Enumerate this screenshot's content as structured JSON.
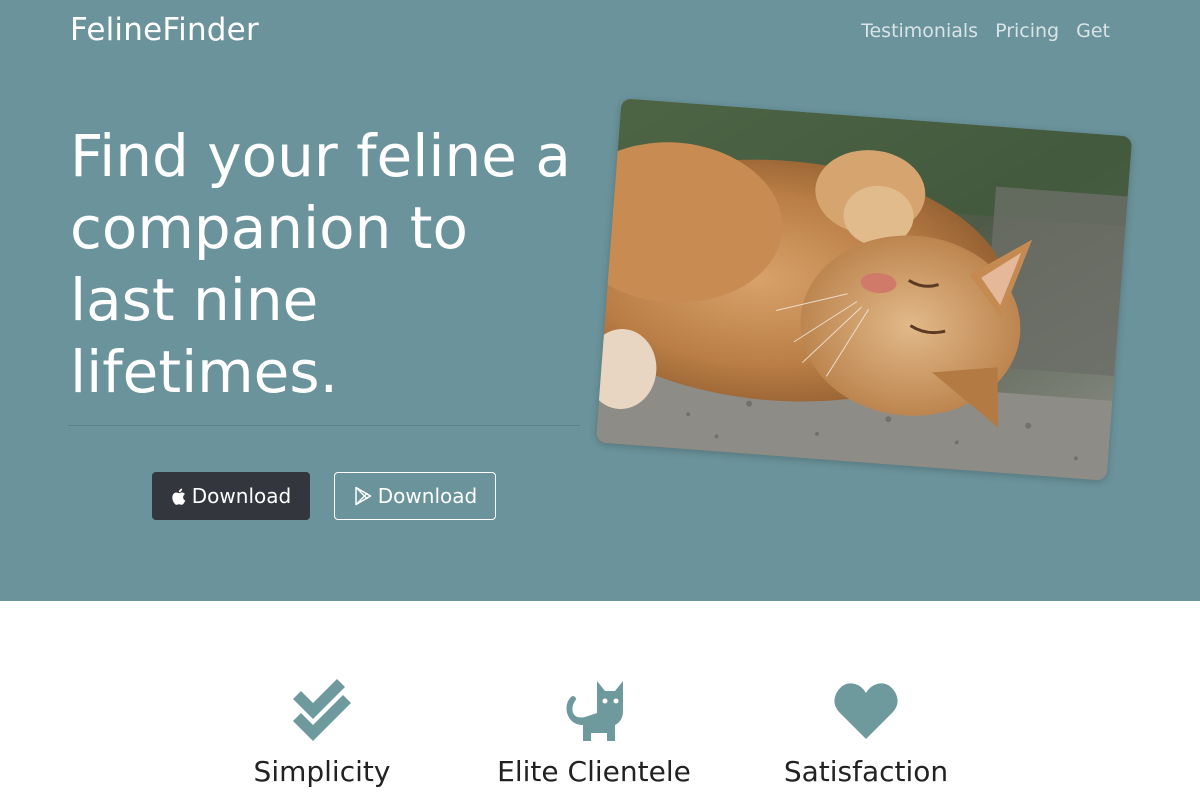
{
  "header": {
    "brand": "FelineFinder",
    "nav": [
      "Testimonials",
      "Pricing",
      "Get"
    ]
  },
  "hero": {
    "headline": "Find your feline a companion to last nine lifetimes.",
    "buttons": {
      "apple": {
        "label": "Download",
        "icon": "apple-icon"
      },
      "play": {
        "label": "Download",
        "icon": "google-play-icon"
      }
    },
    "photo": {
      "subject": "cat-photo"
    }
  },
  "features": [
    {
      "label": "Simplicity",
      "icon": "double-check-icon"
    },
    {
      "label": "Elite Clientele",
      "icon": "cat-icon"
    },
    {
      "label": "Satisfaction",
      "icon": "heart-icon"
    }
  ],
  "colors": {
    "hero_bg": "#6b939b",
    "accent": "#6f9a9d",
    "apple_button": "#33373d",
    "text_dark": "#222222"
  }
}
